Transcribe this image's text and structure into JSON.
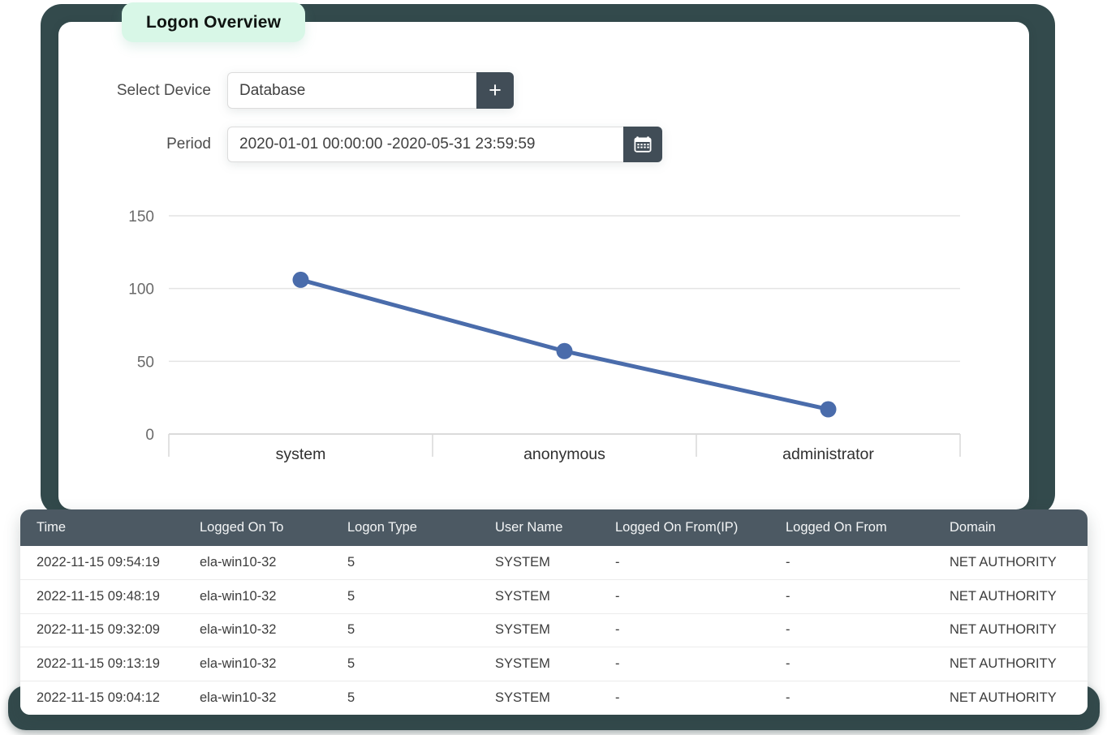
{
  "badge": {
    "label": "Logon Overview"
  },
  "filters": {
    "device_label": "Select Device",
    "device_value": "Database",
    "add_device_label": "+",
    "period_label": "Period",
    "period_value": "2020-01-01 00:00:00 -2020-05-31 23:59:59",
    "calendar_icon": "calendar-icon"
  },
  "chart_data": {
    "type": "line",
    "categories": [
      "system",
      "anonymous",
      "administrator"
    ],
    "values": [
      106,
      57,
      17
    ],
    "title": "",
    "xlabel": "",
    "ylabel": "",
    "ylim": [
      0,
      150
    ],
    "yticks": [
      0,
      50,
      100,
      150
    ],
    "grid": true,
    "legend": "none",
    "line_color": "#4a6cab"
  },
  "table": {
    "headers": [
      "Time",
      "Logged On To",
      "Logon Type",
      "User Name",
      "Logged On From(IP)",
      "Logged On From",
      "Domain"
    ],
    "rows": [
      [
        "2022-11-15 09:54:19",
        "ela-win10-32",
        "5",
        "SYSTEM",
        "-",
        "-",
        "NET AUTHORITY"
      ],
      [
        "2022-11-15 09:48:19",
        "ela-win10-32",
        "5",
        "SYSTEM",
        "-",
        "-",
        "NET AUTHORITY"
      ],
      [
        "2022-11-15 09:32:09",
        "ela-win10-32",
        "5",
        "SYSTEM",
        "-",
        "-",
        "NET AUTHORITY"
      ],
      [
        "2022-11-15 09:13:19",
        "ela-win10-32",
        "5",
        "SYSTEM",
        "-",
        "-",
        "NET AUTHORITY"
      ],
      [
        "2022-11-15 09:04:12",
        "ela-win10-32",
        "5",
        "SYSTEM",
        "-",
        "-",
        "NET AUTHORITY"
      ]
    ]
  },
  "colors": {
    "frame": "#334a4c",
    "badge_bg": "#d8f7e7",
    "button_bg": "#414d57",
    "table_header_bg": "#4c5963",
    "chart_line": "#4a6cab",
    "gridline": "#e4e4e4"
  }
}
